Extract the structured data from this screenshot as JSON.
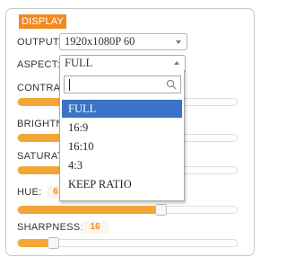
{
  "panel": {
    "title": "DISPLAY"
  },
  "output": {
    "label": "OUTPUT:",
    "value": "1920x1080P 60"
  },
  "aspect": {
    "label": "ASPECT:",
    "value": "FULL",
    "search_value": "",
    "options": [
      {
        "label": "FULL",
        "selected": true
      },
      {
        "label": "16:9",
        "selected": false
      },
      {
        "label": "16:10",
        "selected": false
      },
      {
        "label": "4:3",
        "selected": false
      },
      {
        "label": "KEEP RATIO",
        "selected": false
      }
    ]
  },
  "sliders": {
    "contrast": {
      "label": "CONTRAS",
      "level": 0.22
    },
    "brightness": {
      "label": "BRIGHTN",
      "level": 0.22
    },
    "saturation": {
      "label": "SATURAT",
      "level": 0.22
    },
    "hue": {
      "label": "HUE:",
      "value": "6",
      "level": 0.65
    },
    "sharpness": {
      "label": "SHARPNESS:",
      "value": "16",
      "level": 0.16
    }
  },
  "colors": {
    "accent": "#f08a24",
    "fill": "#f3a536",
    "selected": "#3c72c8"
  },
  "icons": {
    "search": "search-icon",
    "dropdown": "chevron-down-icon",
    "dropup": "chevron-up-icon"
  }
}
